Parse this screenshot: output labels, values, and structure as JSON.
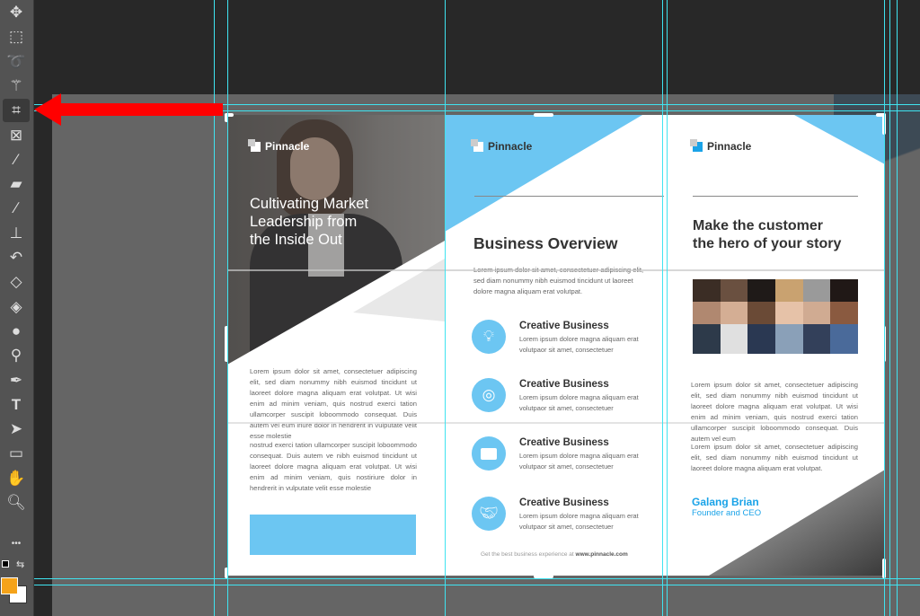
{
  "toolbar": {
    "tools": [
      "move-tool",
      "marquee-tool",
      "lasso-tool",
      "magic-wand-tool",
      "crop-tool",
      "frame-tool",
      "eyedropper-tool",
      "healing-tool",
      "brush-tool",
      "clone-stamp-tool",
      "history-brush-tool",
      "eraser-tool",
      "paint-bucket-tool",
      "blur-tool",
      "dodge-tool",
      "pen-tool",
      "type-tool",
      "path-selection-tool",
      "rectangle-tool",
      "hand-tool",
      "zoom-tool",
      "more-tools"
    ],
    "active_tool": "crop-tool",
    "foreground_color": "#f5a31a",
    "background_color": "#ffffff"
  },
  "annotation": {
    "arrow_color": "#ff0000",
    "points_to": "crop-tool"
  },
  "colors": {
    "accent": "#6cc6f2",
    "brand_blue": "#1aa3e8",
    "guide": "#3fe3f0"
  },
  "panel1": {
    "logo": "Pinnacle",
    "headline": [
      "Cultivating Market",
      "Leadership from",
      "the Inside Out"
    ],
    "para1": "Lorem ipsum dolor sit amet, consectetuer adipiscing elit, sed diam nonummy nibh euismod tincidunt ut laoreet dolore magna aliquam erat volutpat. Ut wisi enim ad minim veniam, quis nostrud exerci tation ullamcorper suscipit loboommodo consequat. Duis autem vel eum iriure dolor in hendrerit in vulputate velit esse molestie",
    "para2": "nostrud exerci tation ullamcorper suscipit loboommodo consequat. Duis autem ve nibh euismod tincidunt ut laoreet dolore magna aliquam erat volutpat. Ut wisi enim ad minim veniam, quis nostiriure dolor in hendrerit in vulputate velit esse molestie"
  },
  "panel2": {
    "logo": "Pinnacle",
    "title": "Business Overview",
    "intro": "Lorem ipsum dolor sit amet, consectetuer adipiscing elit, sed diam nonummy nibh euismod tincidunt ut laoreet dolore magna aliquam erat volutpat.",
    "services": [
      {
        "icon": "lightbulb-icon",
        "title": "Creative Business",
        "text": "Lorem ipsum dolore magna aliquam erat volutpaor sit amet, consectetuer"
      },
      {
        "icon": "target-icon",
        "title": "Creative Business",
        "text": "Lorem ipsum dolore magna aliquam erat volutpaor sit amet, consectetuer"
      },
      {
        "icon": "briefcase-icon",
        "title": "Creative Business",
        "text": "Lorem ipsum dolore magna aliquam erat volutpaor sit amet, consectetuer"
      },
      {
        "icon": "handshake-icon",
        "title": "Creative Business",
        "text": "Lorem ipsum dolore magna aliquam erat volutpaor sit amet, consectetuer"
      }
    ],
    "footer_prefix": "Get the best business experience at ",
    "footer_url": "www.pinnacle.com"
  },
  "panel3": {
    "logo": "Pinnacle",
    "headline": [
      "Make the customer",
      "the hero of your story"
    ],
    "para1": "Lorem ipsum dolor sit amet, consectetuer adipiscing elit, sed diam nonummy nibh euismod tincidunt ut laoreet dolore magna aliquam erat volutpat. Ut wisi enim ad minim veniam, quis nostrud exerci tation ullamcorper suscipit loboommodo consequat. Duis autem vel eum",
    "para2": "Lorem ipsum dolor sit amet, consectetuer adipiscing elit, sed diam nonummy nibh euismod tincidunt ut laoreet dolore magna aliquam erat volutpat.",
    "name": "Galang Brian",
    "role": "Founder and CEO"
  }
}
